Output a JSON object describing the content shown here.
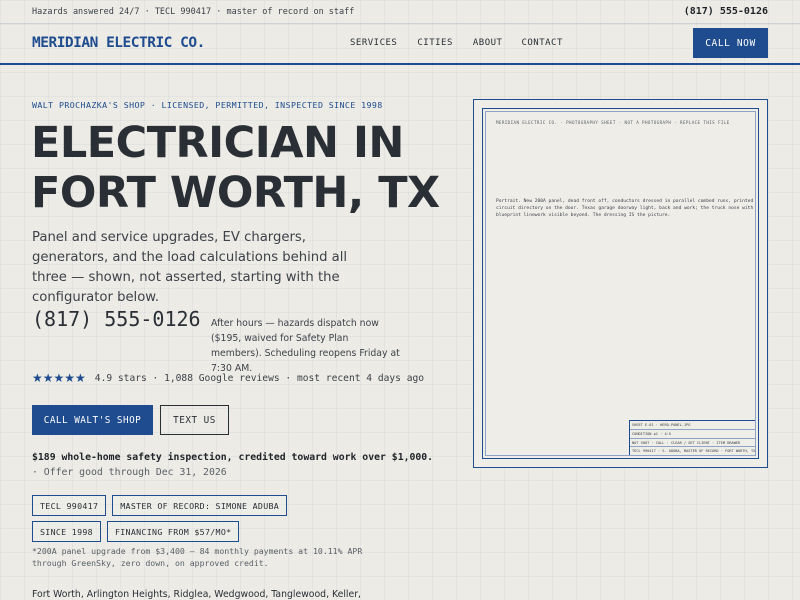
{
  "topbar": {
    "tagline": "Hazards answered 24/7 · TECL 990417 · master of record on staff",
    "phone": "(817) 555-0126"
  },
  "header": {
    "brand": "MERIDIAN ELECTRIC CO.",
    "nav": [
      "SERVICES",
      "CITIES",
      "ABOUT",
      "CONTACT"
    ],
    "cta": "CALL NOW"
  },
  "hero": {
    "eyebrow": "WALT PROCHAZKA'S SHOP · LICENSED, PERMITTED, INSPECTED SINCE 1998",
    "title_line1": "ELECTRICIAN IN",
    "title_line2": "FORT WORTH, TX",
    "lede": "Panel and service upgrades, EV chargers, generators, and the load calculations behind all three — shown, not asserted, starting with the configurator below.",
    "phone": "(817) 555-0126",
    "after_hours": "After hours — hazards dispatch now ($195, waived for Safety Plan members). Scheduling reopens Friday at 7:30 AM.",
    "stars": "★★★★★",
    "rating_value": 4.9,
    "rating_text": "4.9 stars · 1,088 Google reviews · most recent 4 days ago",
    "primary_button": "CALL WALT'S SHOP",
    "secondary_button": "TEXT US",
    "offer_bold": "$189 whole-home safety inspection, credited toward work over $1,000.",
    "offer_rest": "· Offer good through Dec 31, 2026",
    "badges": [
      "TECL 990417",
      "MASTER OF RECORD: SIMONE ADUBA",
      "SINCE 1998",
      "FINANCING FROM $57/MO*"
    ],
    "financing_note": "*200A panel upgrade from $3,400 — 84 monthly payments at 10.11% APR through GreenSky, zero down, on approved credit.",
    "areas": "Fort Worth, Arlington Heights, Ridglea, Wedgwood, Tanglewood, Keller,"
  },
  "sheet": {
    "header": "MERIDIAN ELECTRIC CO. · PHOTOGRAPHY SHEET · NOT A PHOTOGRAPH · REPLACE THIS FILE",
    "description": "Portrait. New 200A panel, dead front off, conductors dressed in parallel combed runs, printed circuit directory on the door. Texas garage doorway light, back and work; the truck nose with blueprint linework visible beyond. The dressing IS the picture.",
    "titleblock": [
      "SHEET E-01 · HERO-PANEL.JPG",
      "CONDITION p1 · 4:5",
      "NOT SHOT · CALL · CLEAR / GET CLIENT · ITEM DRAWER",
      "TECL 990417 · S. ADUBA, MASTER OF RECORD · FORT WORTH, TX"
    ]
  },
  "colors": {
    "accent": "#1e4c8e",
    "background": "#ecebe6",
    "text": "#2a2f36"
  }
}
